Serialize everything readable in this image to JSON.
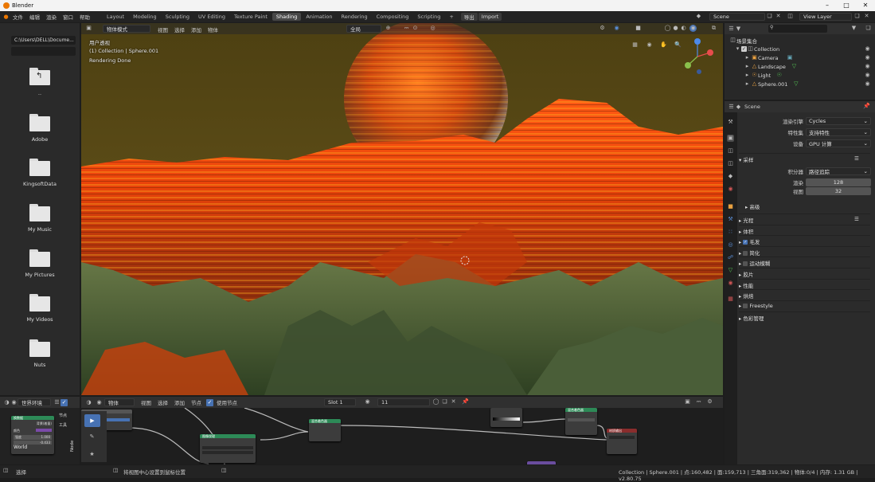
{
  "window": {
    "title": "Blender"
  },
  "menubar": {
    "items": [
      "文件",
      "编辑",
      "渲染",
      "窗口",
      "帮助"
    ]
  },
  "workspaces": {
    "tabs": [
      "Layout",
      "Modeling",
      "Sculpting",
      "UV Editing",
      "Texture Paint",
      "Shading",
      "Animation",
      "Rendering",
      "Compositing",
      "Scripting"
    ],
    "active": "Shading",
    "add": "+",
    "export": "导出",
    "import": "Import"
  },
  "scene": {
    "label": "Scene",
    "view_layer": "View Layer"
  },
  "filebrowser": {
    "view_label": "视图",
    "path": "C:\\Users\\DELL\\Docume...",
    "folders": [
      "",
      "Adobe",
      "KingsoftData",
      "My Music",
      "My Pictures",
      "My Videos",
      "Nuts"
    ],
    "parent_label": ".."
  },
  "viewport": {
    "mode": "物体模式",
    "menu": [
      "视图",
      "选择",
      "添加",
      "物体"
    ],
    "transform": "全局",
    "overlay_lines": [
      "用户透视",
      "(1) Collection | Sphere.001",
      "Rendering Done"
    ]
  },
  "outliner": {
    "root": "场景集合",
    "collection": "Collection",
    "items": [
      "Camera",
      "Landscape",
      "Light",
      "Sphere.001"
    ],
    "search_placeholder": ""
  },
  "properties": {
    "scene_name": "Scene",
    "render_engine_label": "渲染引擎",
    "render_engine": "Cycles",
    "feature_set_label": "特性集",
    "feature_set": "支持特性",
    "device_label": "设备",
    "device": "GPU 计算",
    "sampling": "采样",
    "integrator_label": "积分器",
    "integrator": "路径追踪",
    "render_label": "渲染",
    "render_samples": "128",
    "viewport_label": "视图",
    "viewport_samples": "32",
    "advanced": "高级",
    "sections": [
      "光程",
      "体积",
      "毛发",
      "简化",
      "运动模糊",
      "胶片",
      "性能",
      "烘焙",
      "Freestyle",
      "色彩管理"
    ]
  },
  "world_panel": {
    "selector": "世界环境",
    "node_title": "换数据",
    "bg_label": "背景(着量)",
    "color_label": "颜色",
    "strength_label": "强度",
    "strength": "1.000",
    "field_val": "-0.433",
    "name": "World",
    "tabs": [
      "节点",
      "工具"
    ],
    "vertical_tab": "Node"
  },
  "node_editor": {
    "type": "物体",
    "menu": [
      "视图",
      "选择",
      "添加",
      "节点"
    ],
    "use_nodes": "使用节点",
    "slot": "Slot 1",
    "material": "11"
  },
  "nodes": {
    "n1_title": "",
    "n2_title": "图像纹理",
    "n3_title": "混合着色器",
    "n4_title": "混合着色器",
    "n5_title": "材质输出"
  },
  "statusbar": {
    "left": "选择",
    "middle": "将视图中心设置到鼠标位置",
    "right": "Collection | Sphere.001 | 点:160,482 | 面:159,713 | 三角面:319,362 | 物体:0/4 | 内存: 1.31 GB | v2.80.75"
  },
  "colors": {
    "accent": "#ea7600",
    "select": "#4772b3",
    "node_green": "#2d8a57",
    "node_red": "#8a2d2d",
    "node_purple": "#6a4d9e"
  }
}
